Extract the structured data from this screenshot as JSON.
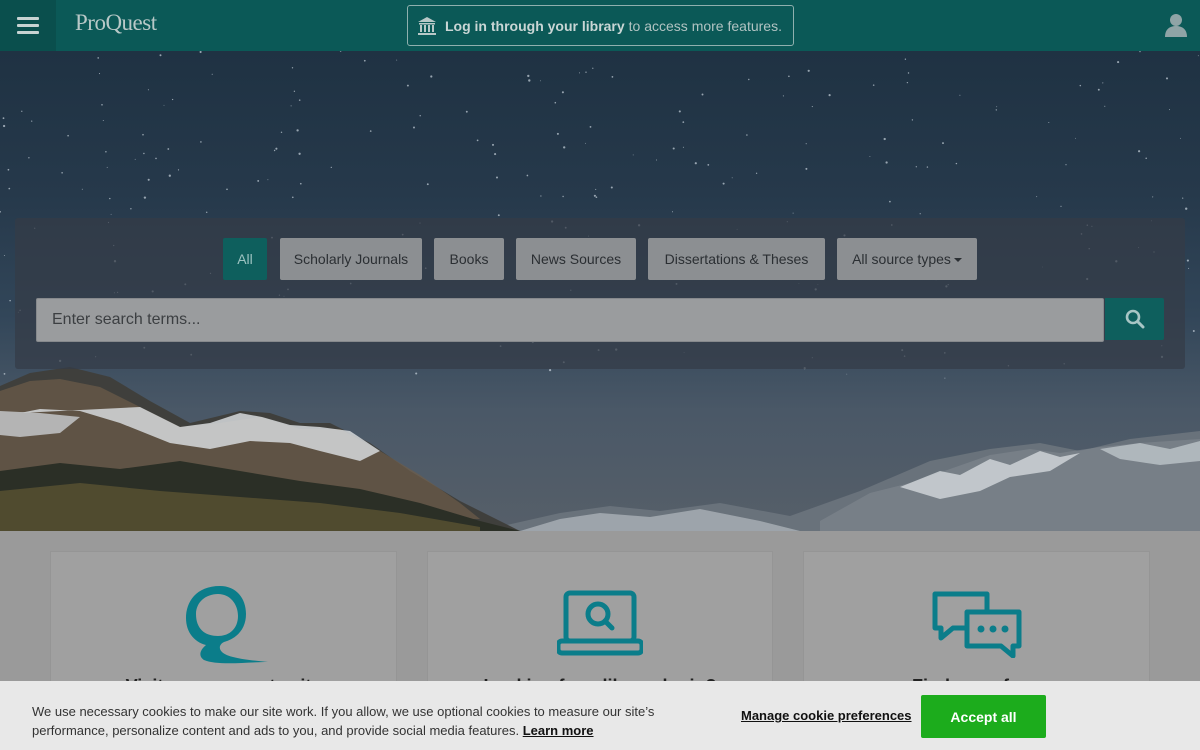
{
  "header": {
    "logo": "ProQuest",
    "login_strong": "Log in through your library",
    "login_rest": "to access more features."
  },
  "search": {
    "chips": [
      "All",
      "Scholarly Journals",
      "Books",
      "News Sources",
      "Dissertations & Theses",
      "All source types"
    ],
    "active_chip": "All",
    "placeholder": "Enter search terms..."
  },
  "cards": [
    {
      "icon": "proquest-q-icon",
      "title": "Visit our corporate site"
    },
    {
      "icon": "laptop-search-icon",
      "title": "Looking for a library login?"
    },
    {
      "icon": "chat-bubbles-icon",
      "title": "Find a rep for..."
    }
  ],
  "cookie": {
    "text": "We use necessary cookies to make our site work. If you allow, we use optional cookies to measure our site’s performance, personalize content and ads to you, and provide social media features.",
    "learn_more": "Learn more",
    "manage": "Manage cookie preferences",
    "accept": "Accept all"
  },
  "colors": {
    "header_bg": "#0b5957",
    "accent_teal": "#0e5f5d",
    "icon_teal": "#0b7d8a",
    "accept_green": "#1cac1c"
  }
}
